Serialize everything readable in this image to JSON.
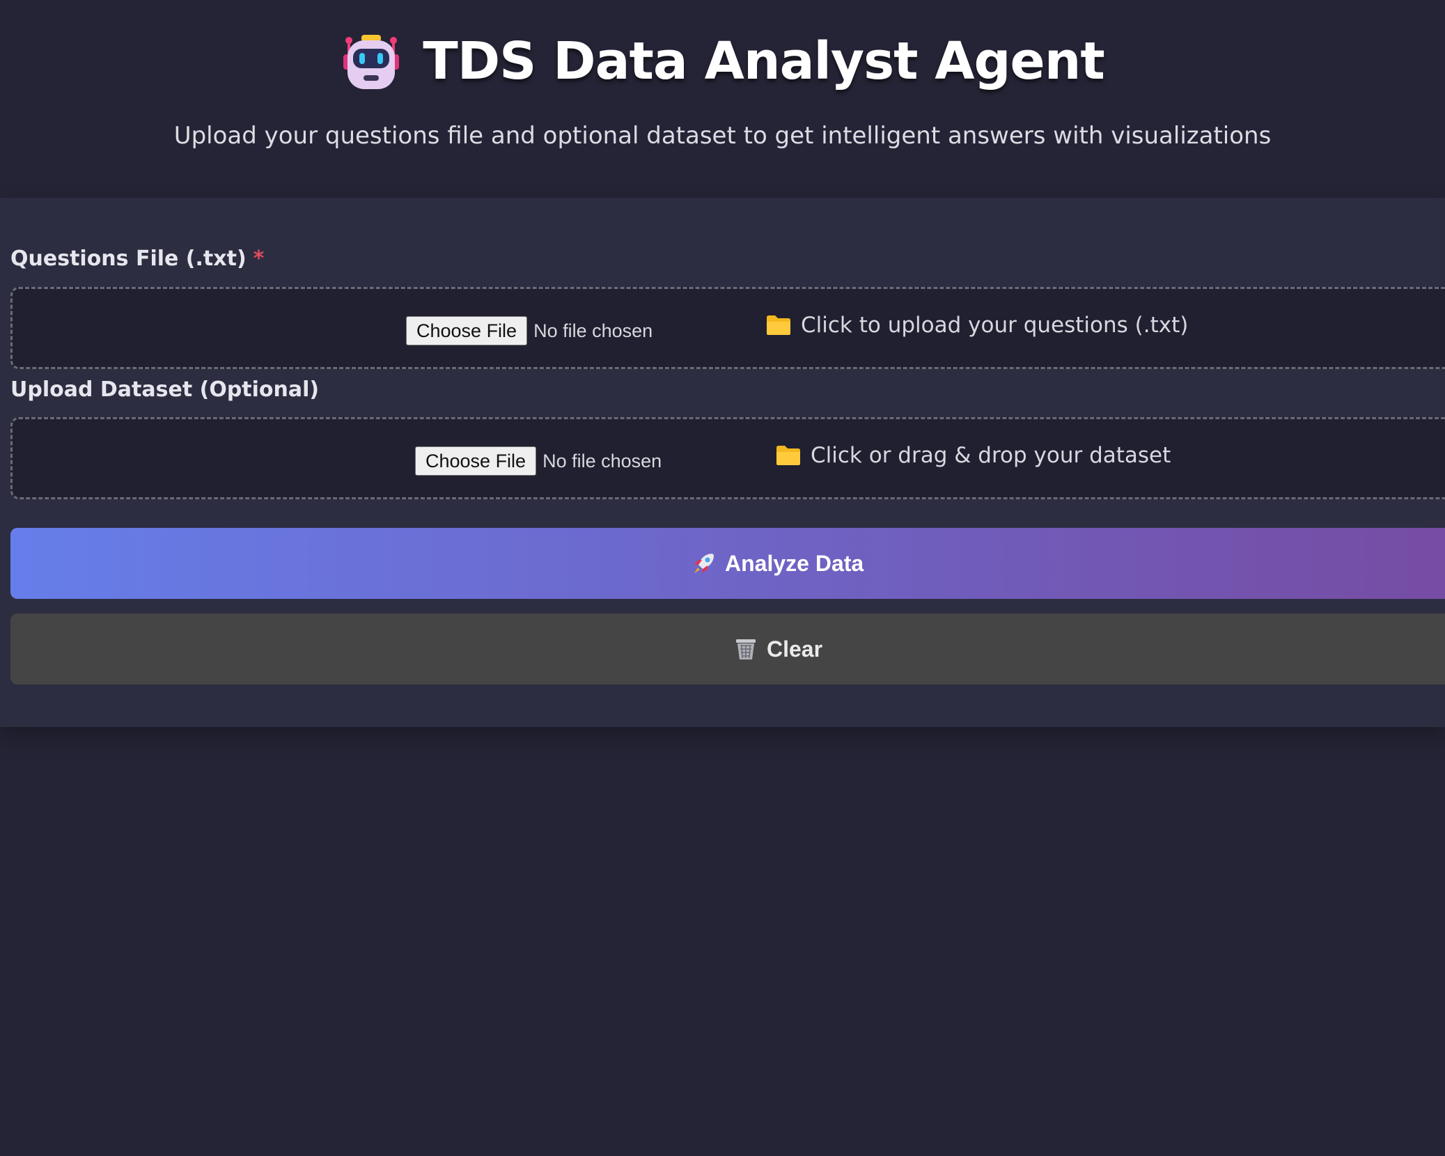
{
  "header": {
    "title": "TDS Data Analyst Agent",
    "subtitle": "Upload your questions file and optional dataset to get intelligent answers with visualizations",
    "icon": "robot-icon"
  },
  "questions_field": {
    "label": "Questions File (.txt)",
    "required_mark": "*",
    "choose_label": "Choose File",
    "status": "No file chosen",
    "hint": "Click to upload your questions (.txt)",
    "icon": "folder-icon"
  },
  "dataset_field": {
    "label": "Upload Dataset (Optional)",
    "choose_label": "Choose File",
    "status": "No file chosen",
    "hint": "Click or drag & drop your dataset",
    "icon": "folder-icon"
  },
  "actions": {
    "analyze_label": "Analyze Data",
    "analyze_icon": "rocket-icon",
    "clear_label": "Clear",
    "clear_icon": "wastebasket-icon"
  },
  "colors": {
    "background": "#242436",
    "panel": "#2d2d41",
    "dropzone": "#202030",
    "gradient_start": "#667eea",
    "gradient_end": "#764ba2",
    "clear_button": "#454545",
    "required": "#e14b5a"
  }
}
